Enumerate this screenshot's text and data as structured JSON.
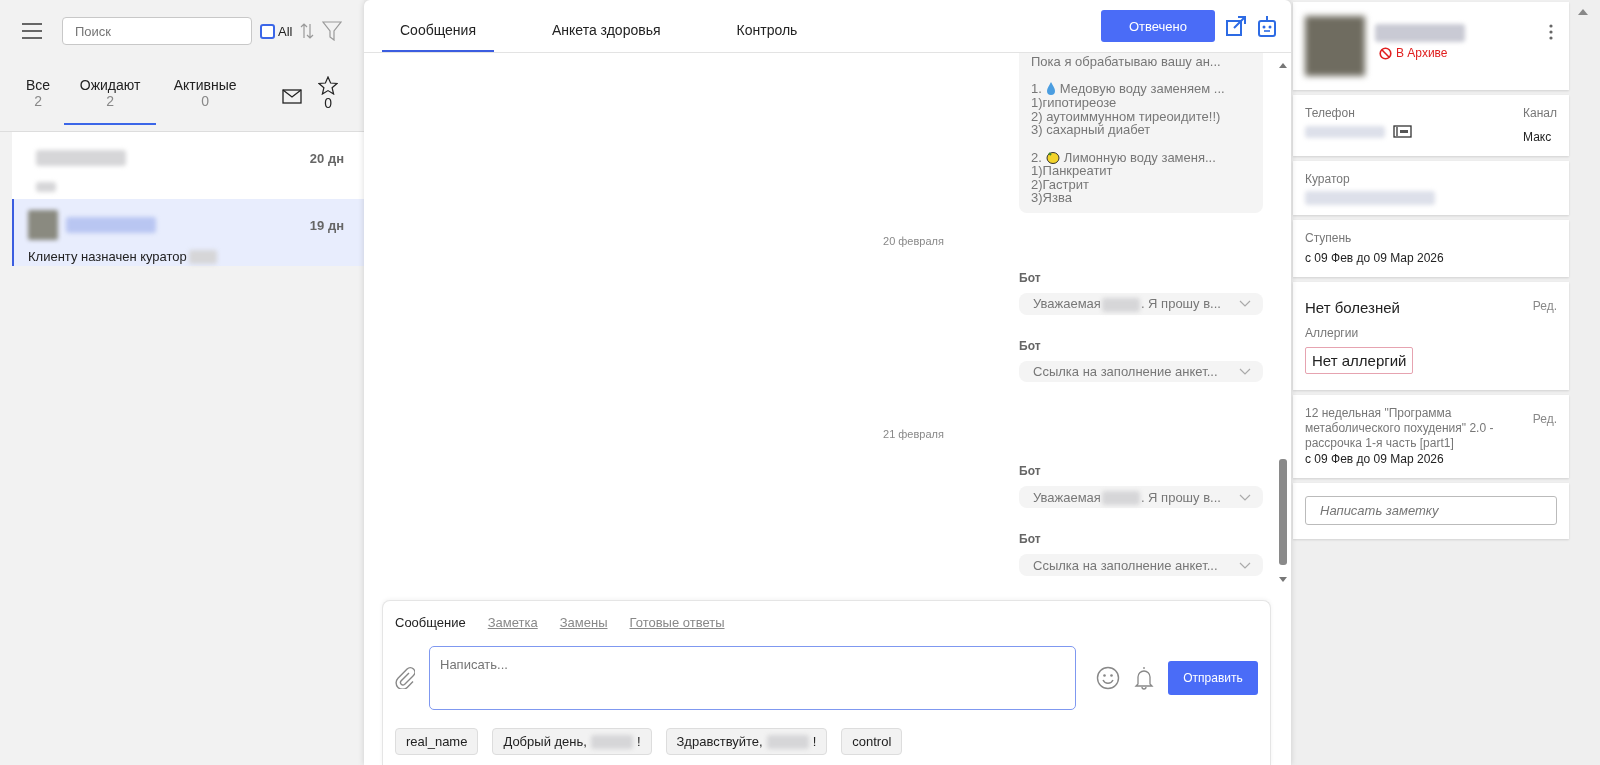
{
  "sidebar": {
    "search": {
      "placeholder": "Поиск"
    },
    "all_filter": {
      "label": "All",
      "checked": false
    },
    "tabs": [
      {
        "label": "Все",
        "count": "2",
        "selected": false
      },
      {
        "label": "Ожидают",
        "count": "2",
        "selected": true
      },
      {
        "label": "Активные",
        "count": "0",
        "selected": false
      }
    ],
    "starred_count": "0",
    "conversations": [
      {
        "time": "20 дн",
        "avatar": false,
        "selected": false
      },
      {
        "time": "19 дн",
        "avatar": true,
        "preview": "Клиенту назначен куратор",
        "selected": true
      }
    ]
  },
  "chat": {
    "tabs": [
      {
        "label": "Сообщения",
        "selected": true
      },
      {
        "label": "Анкета здоровья",
        "selected": false
      },
      {
        "label": "Контроль",
        "selected": false
      }
    ],
    "status_button": "Отвечено",
    "messages": [
      {
        "kind": "text",
        "lines": [
          {
            "kind": "plain",
            "text": "Пока я обрабатываю вашу ан..."
          },
          {
            "kind": "blank"
          },
          {
            "kind": "numbered",
            "number": "1.",
            "text": "Медовую воду заменяем ..."
          },
          {
            "kind": "plain",
            "text": "1)гипотиреозе"
          },
          {
            "kind": "plain",
            "text": "2) аутоиммунном тиреоидите!!)"
          },
          {
            "kind": "plain",
            "text": "3) сахарный диабет"
          },
          {
            "kind": "blank"
          },
          {
            "kind": "numbered",
            "number": "2.",
            "text": "Лимонную воду заменя..."
          },
          {
            "kind": "plain",
            "text": "1)Панкреатит"
          },
          {
            "kind": "plain",
            "text": "2)Гастрит"
          },
          {
            "kind": "plain",
            "text": "3)Язва"
          }
        ]
      },
      {
        "kind": "date",
        "text": "20 февраля"
      },
      {
        "kind": "bot",
        "sender": "Бот",
        "text": "Уважаемая",
        "redacted": true,
        "text_after": ". Я прошу в...",
        "expanded": false
      },
      {
        "kind": "bot",
        "sender": "Бот",
        "text": "Ссылка на заполнение анкет...",
        "redacted": false,
        "expanded": false
      },
      {
        "kind": "date",
        "text": "21 февраля"
      },
      {
        "kind": "bot",
        "sender": "Бот",
        "text": "Уважаемая",
        "redacted": true,
        "text_after": ". Я прошу в...",
        "expanded": false
      },
      {
        "kind": "bot",
        "sender": "Бот",
        "text": "Ссылка на заполнение анкет...",
        "redacted": false,
        "expanded": false
      }
    ]
  },
  "composer": {
    "tabs": [
      {
        "label": "Сообщение",
        "selected": true
      },
      {
        "label": "Заметка",
        "selected": false
      },
      {
        "label": "Замены",
        "selected": false
      },
      {
        "label": "Готовые ответы",
        "selected": false
      }
    ],
    "placeholder": "Написать...",
    "send_button": "Отправить",
    "templates": [
      {
        "text": "real_name",
        "redacted": false
      },
      {
        "text": "Добрый день,",
        "redacted": true,
        "text_after": "!"
      },
      {
        "text": "Здравствуйте,",
        "redacted": true,
        "text_after": "!"
      },
      {
        "text": "control",
        "redacted": false
      }
    ]
  },
  "profile": {
    "status": "В Архиве",
    "phone_label": "Телефон",
    "channel_label": "Канал",
    "channel": "Макс",
    "curator_label": "Куратор",
    "stage_label": "Ступень",
    "stage_dates": "с 09 Фев до 09 Мар 2026",
    "diseases": "Нет болезней",
    "edit_link": "Ред.",
    "allergies_label": "Аллергии",
    "allergies": "Нет аллергий",
    "program": "12 недельная \"Программа метаболического похудения\" 2.0 - рассрочка 1-я часть [part1]",
    "program_edit_link": "Ред.",
    "program_dates": "с 09 Фев до 09 Мар 2026",
    "note_placeholder": "Написать заметку"
  }
}
